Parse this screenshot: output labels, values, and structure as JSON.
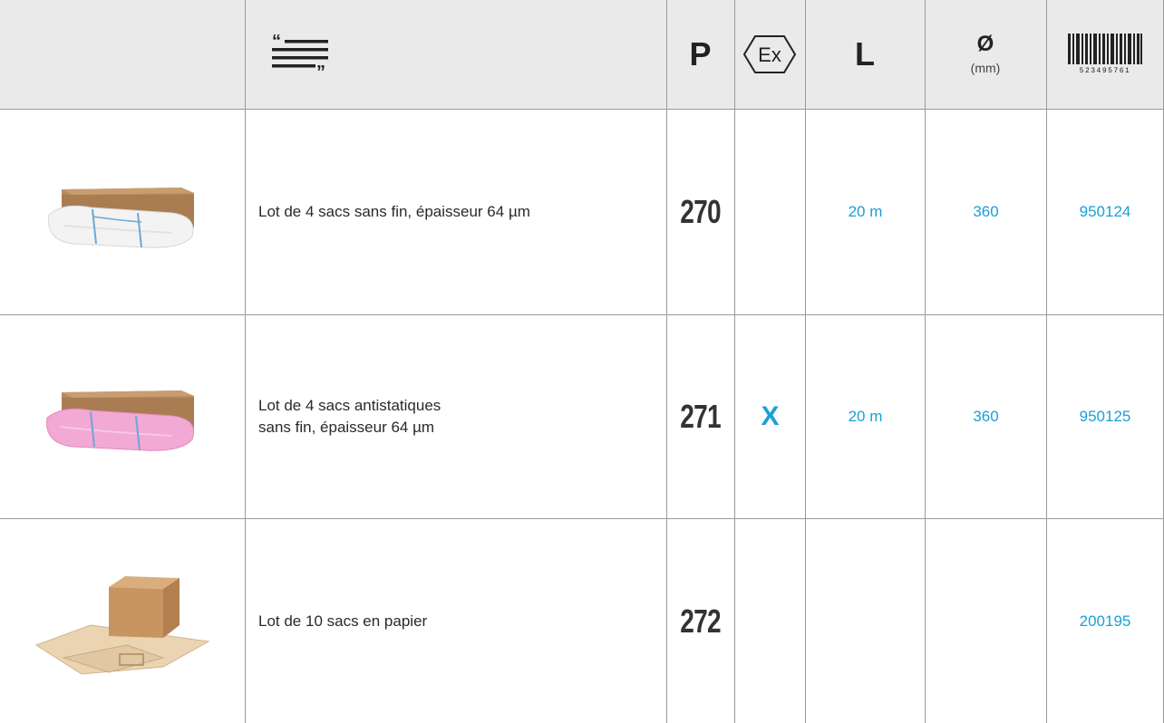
{
  "header": {
    "description_icon": "quote-lines-icon",
    "p_label": "P",
    "ex_icon": "atex-ex-icon",
    "ex_label": "Ex",
    "length_label": "L",
    "diameter_symbol": "Ø",
    "diameter_unit": "(mm)",
    "barcode_icon": "barcode-icon",
    "barcode_number": "523495761"
  },
  "rows": [
    {
      "image": "box-with-white-bags",
      "description_line1": "Lot de 4 sacs sans fin, épaisseur 64 µm",
      "description_line2": "",
      "p": "270",
      "ex": "",
      "length": "20 m",
      "diameter": "360",
      "ref": "950124"
    },
    {
      "image": "box-with-pink-bags",
      "description_line1": "Lot de 4 sacs antistatiques",
      "description_line2": "sans fin, épaisseur 64 µm",
      "p": "271",
      "ex": "X",
      "length": "20 m",
      "diameter": "360",
      "ref": "950125"
    },
    {
      "image": "box-with-paper-bags",
      "description_line1": "Lot de 10 sacs en papier",
      "description_line2": "",
      "p": "272",
      "ex": "",
      "length": "",
      "diameter": "",
      "ref": "200195"
    }
  ]
}
